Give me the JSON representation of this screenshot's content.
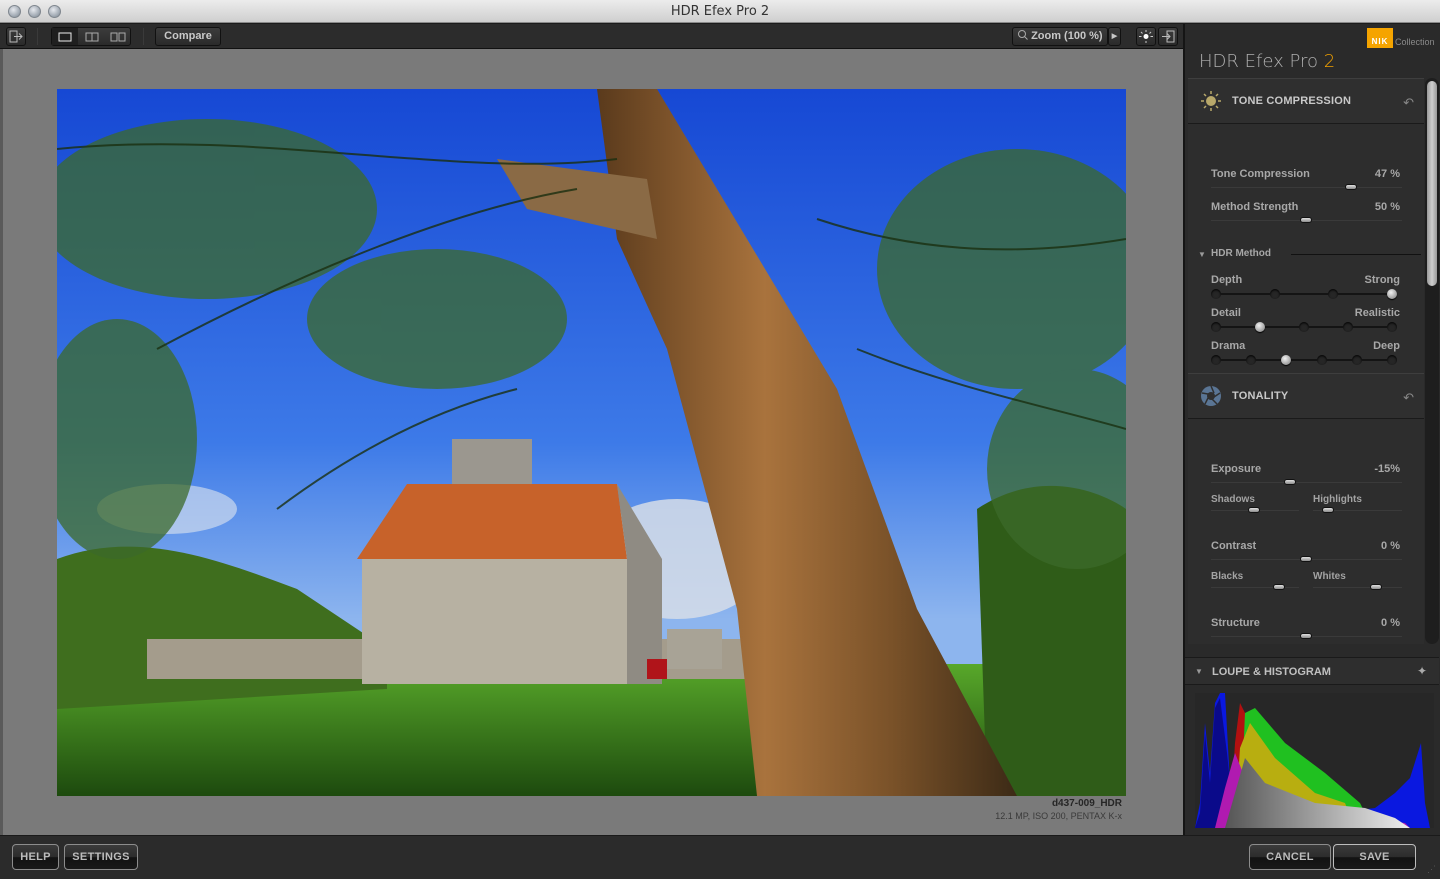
{
  "window": {
    "title": "HDR Efex Pro 2"
  },
  "toolbar": {
    "exit_icon": "exit-icon",
    "view_single": "single-view-icon",
    "view_split": "split-view-icon",
    "view_side_by_side": "side-by-side-view-icon",
    "compare_label": "Compare",
    "zoom_label": "Zoom (100 %)",
    "zoom_icon": "magnifier-icon",
    "background_icon": "light-bulb-icon",
    "panel_toggle_icon": "panel-toggle-icon"
  },
  "image": {
    "name": "d437-009_HDR",
    "info": "12.1 MP, ISO 200, PENTAX K-x",
    "description": "HDR photo of a stone church with orange-tiled roof behind a willow tree trunk under a blue sky"
  },
  "panel": {
    "brand": "NIK",
    "brand_suffix": "Collection",
    "brand_color": "#f5a400",
    "title": "HDR Efex Pro",
    "version": "2",
    "sections": {
      "tone_compression": {
        "title": "TONE COMPRESSION",
        "icon": "sun-icon",
        "sliders": [
          {
            "label": "Tone Compression",
            "value": "47 %",
            "fraction": 0.74
          },
          {
            "label": "Method Strength",
            "value": "50 %",
            "fraction": 0.5
          }
        ],
        "hdr_method": {
          "label": "HDR Method",
          "rows": [
            {
              "label": "Depth",
              "right": "Strong",
              "stops": 4,
              "selected": 3
            },
            {
              "label": "Detail",
              "right": "Realistic",
              "stops": 5,
              "selected": 1
            },
            {
              "label": "Drama",
              "right": "Deep",
              "stops": 6,
              "selected": 2
            }
          ]
        }
      },
      "tonality": {
        "title": "TONALITY",
        "icon": "aperture-icon",
        "exposure": {
          "label": "Exposure",
          "value": "-15%",
          "fraction": 0.42
        },
        "shadows": {
          "label": "Shadows",
          "fraction": 0.5
        },
        "highlights": {
          "label": "Highlights",
          "fraction": 0.18
        },
        "contrast": {
          "label": "Contrast",
          "value": "0 %",
          "fraction": 0.5
        },
        "blacks": {
          "label": "Blacks",
          "fraction": 0.78
        },
        "whites": {
          "label": "Whites",
          "fraction": 0.72
        },
        "structure": {
          "label": "Structure",
          "value": "0 %",
          "fraction": 0.5
        }
      },
      "loupe": {
        "title": "LOUPE & HISTOGRAM",
        "pin_icon": "pin-icon"
      }
    }
  },
  "footer": {
    "help": "HELP",
    "settings": "SETTINGS",
    "cancel": "CANCEL",
    "save": "SAVE"
  }
}
